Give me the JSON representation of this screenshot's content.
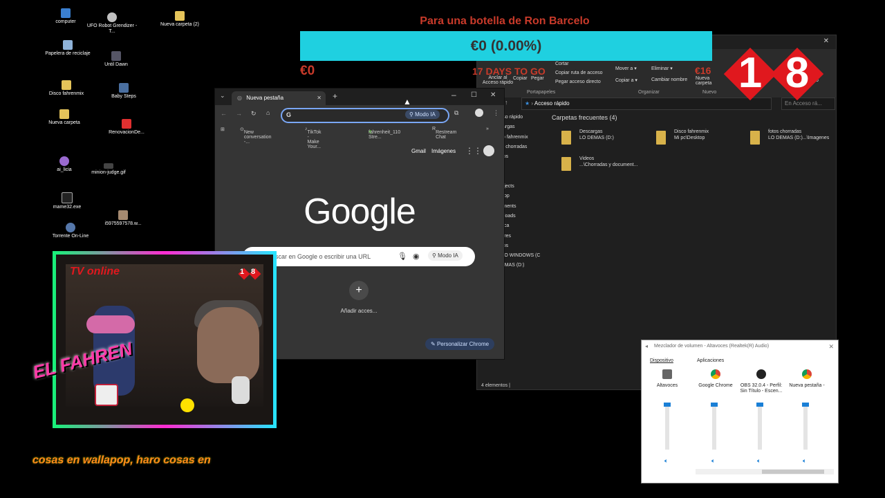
{
  "desktop": {
    "icons": [
      {
        "label": "computer"
      },
      {
        "label": "Papelera de reciclaje"
      },
      {
        "label": "Disco fahrenmix"
      },
      {
        "label": "Nueva carpeta"
      },
      {
        "label": "UFO Robot Grendizer - T..."
      },
      {
        "label": "Until Dawn"
      },
      {
        "label": "Baby Steps"
      },
      {
        "label": "RenovacionDe..."
      },
      {
        "label": "Nueva carpeta (2)"
      },
      {
        "label": "ai_licia"
      },
      {
        "label": "minion-judge.gif"
      },
      {
        "label": "mame32.exe"
      },
      {
        "label": "i5975597578.w..."
      },
      {
        "label": "Torrente On-Line"
      }
    ]
  },
  "donation": {
    "title": "Para una botella de Ron Barcelo",
    "progress_text": "€0 (0.00%)",
    "progress_fraction": 0.0,
    "raised": "€0",
    "days_left": "17 DAYS TO GO",
    "goal": "€16",
    "bar_color": "#1fd0e0",
    "text_color": "#c83a2a"
  },
  "badge": {
    "digit1": "1",
    "digit2": "8",
    "color": "#e0181e"
  },
  "explorer": {
    "ribbon": {
      "cortar": "Cortar",
      "copiar_ruta": "Copiar ruta de acceso",
      "pegar_acceso": "Pegar acceso directo",
      "anclar": "Anclar al Acceso rápido",
      "copiar": "Copiar",
      "pegar": "Pegar",
      "mover": "Mover a ▾",
      "copiar_a": "Copiar a ▾",
      "eliminar": "Eliminar ▾",
      "cambiar_nombre": "Cambiar nombre",
      "nueva_carpeta": "Nueva carpeta",
      "group_portapapeles": "Portapapeles",
      "group_organizar": "Organizar",
      "group_nuevo": "Nuevo",
      "abrir_partial": "o",
      "search_placeholder": "En Acceso rá..."
    },
    "address": "Acceso rápido",
    "nav": [
      "ceso rápido",
      "scargas",
      "sco fahrenmix",
      "tos chorradas",
      "deos",
      "",
      "pc",
      "Objects",
      "sktop",
      "cuments",
      "wnloads",
      "úsica",
      "ctures",
      "deos",
      "OLO WINDOWS (C",
      "DEMAS (D:)"
    ],
    "section": "Carpetas frecuentes (4)",
    "folders": [
      {
        "name": "Descargas",
        "path": "LO DEMAS (D:)"
      },
      {
        "name": "Disco fahrenmix",
        "path": "Mi pc\\Desktop"
      },
      {
        "name": "fotos chorradas",
        "path": "LO DEMAS (D:)...\\Imagenes"
      },
      {
        "name": "Videos",
        "path": "...\\Chorradas y document..."
      }
    ],
    "status": "4 elementos"
  },
  "chrome": {
    "tab_title": "Nueva pestaña",
    "omnibox_value": "",
    "omnibox_mode": "Modo IA",
    "bookmarks": [
      "New conversation -...",
      "TikTok - Make Your...",
      "fahrenheit_110 Stre...",
      "Restream Chat"
    ],
    "links": {
      "gmail": "Gmail",
      "images": "Imágenes"
    },
    "logo": "Google",
    "search_placeholder": "Buscar en Google o escribir una URL",
    "search_mode": "Modo IA",
    "shortcut_label": "Añadir acces...",
    "customize": "Personalizar Chrome"
  },
  "webcam": {
    "overlay_title": "TV online",
    "overlay_badge": [
      "1",
      "8"
    ],
    "brand": "EL FAHREN"
  },
  "ticker": {
    "text": "cosas en wallapop, haro cosas en"
  },
  "mixer": {
    "title": "Mezclador de volumen - Altavoces (Realtek(R) Audio)",
    "device_header": "Dispositivo",
    "apps_header": "Aplicaciones",
    "channels": [
      {
        "label": "Altavoces",
        "level": 1.0
      },
      {
        "label": "Google Chrome",
        "level": 1.0
      },
      {
        "label": "OBS 32.0.4 - Perfil: Sin Título - Escen...",
        "level": 1.0
      },
      {
        "label": "Nueva pestaña -",
        "level": 1.0
      }
    ]
  }
}
